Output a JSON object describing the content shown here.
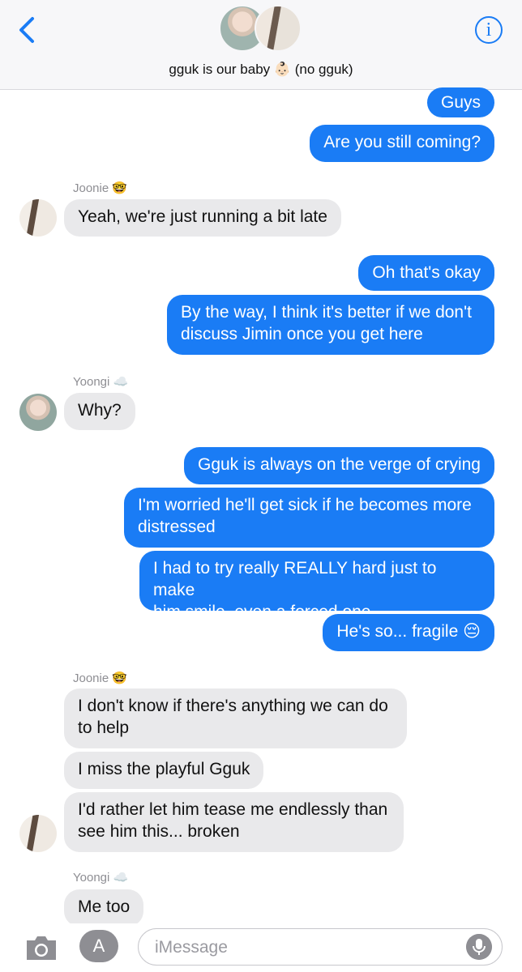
{
  "header": {
    "back_label": "<",
    "group_name": "gguk is our baby 👶🏻 (no gguk)",
    "info_label": "i"
  },
  "messages": [
    {
      "id": "m1",
      "text": "Guys",
      "side": "out"
    },
    {
      "id": "m2",
      "text": "Are you still coming?",
      "side": "out"
    },
    {
      "id": "s1",
      "sender": "Joonie 🤓"
    },
    {
      "id": "m3",
      "text": "Yeah, we're just running a bit late",
      "side": "in"
    },
    {
      "id": "m4",
      "text": "Oh that's okay",
      "side": "out"
    },
    {
      "id": "m5",
      "text": "By the way, I think it's better if we don't\ndiscuss Jimin once you get here",
      "side": "out"
    },
    {
      "id": "s2",
      "sender": "Yoongi ☁️"
    },
    {
      "id": "m6",
      "text": "Why?",
      "side": "in"
    },
    {
      "id": "m7",
      "text": "Gguk is always on the verge of crying",
      "side": "out"
    },
    {
      "id": "m8",
      "text": "I'm worried he'll get sick if he becomes more\ndistressed",
      "side": "out"
    },
    {
      "id": "m9",
      "text": "I had to try really REALLY hard just to make\nhim smile, even a forced one",
      "side": "out"
    },
    {
      "id": "m10",
      "text": "He's so... fragile 😔",
      "side": "out"
    },
    {
      "id": "s3",
      "sender": "Joonie 🤓"
    },
    {
      "id": "m11",
      "text": "I don't know if there's anything we can do\nto help",
      "side": "in"
    },
    {
      "id": "m12",
      "text": "I miss the playful Gguk",
      "side": "in"
    },
    {
      "id": "m13",
      "text": "I'd rather let him tease me endlessly than\nsee him this... broken",
      "side": "in"
    },
    {
      "id": "s4",
      "sender": "Yoongi ☁️"
    },
    {
      "id": "m14",
      "text": "Me too",
      "side": "in"
    }
  ],
  "input": {
    "placeholder": "iMessage"
  },
  "colors": {
    "accent": "#1a7cf5",
    "incoming_bubble": "#e9e9eb",
    "secondary_text": "#8e8e93"
  },
  "icons": [
    "chevron-left-icon",
    "info-icon",
    "camera-icon",
    "app-store-icon",
    "microphone-icon"
  ]
}
